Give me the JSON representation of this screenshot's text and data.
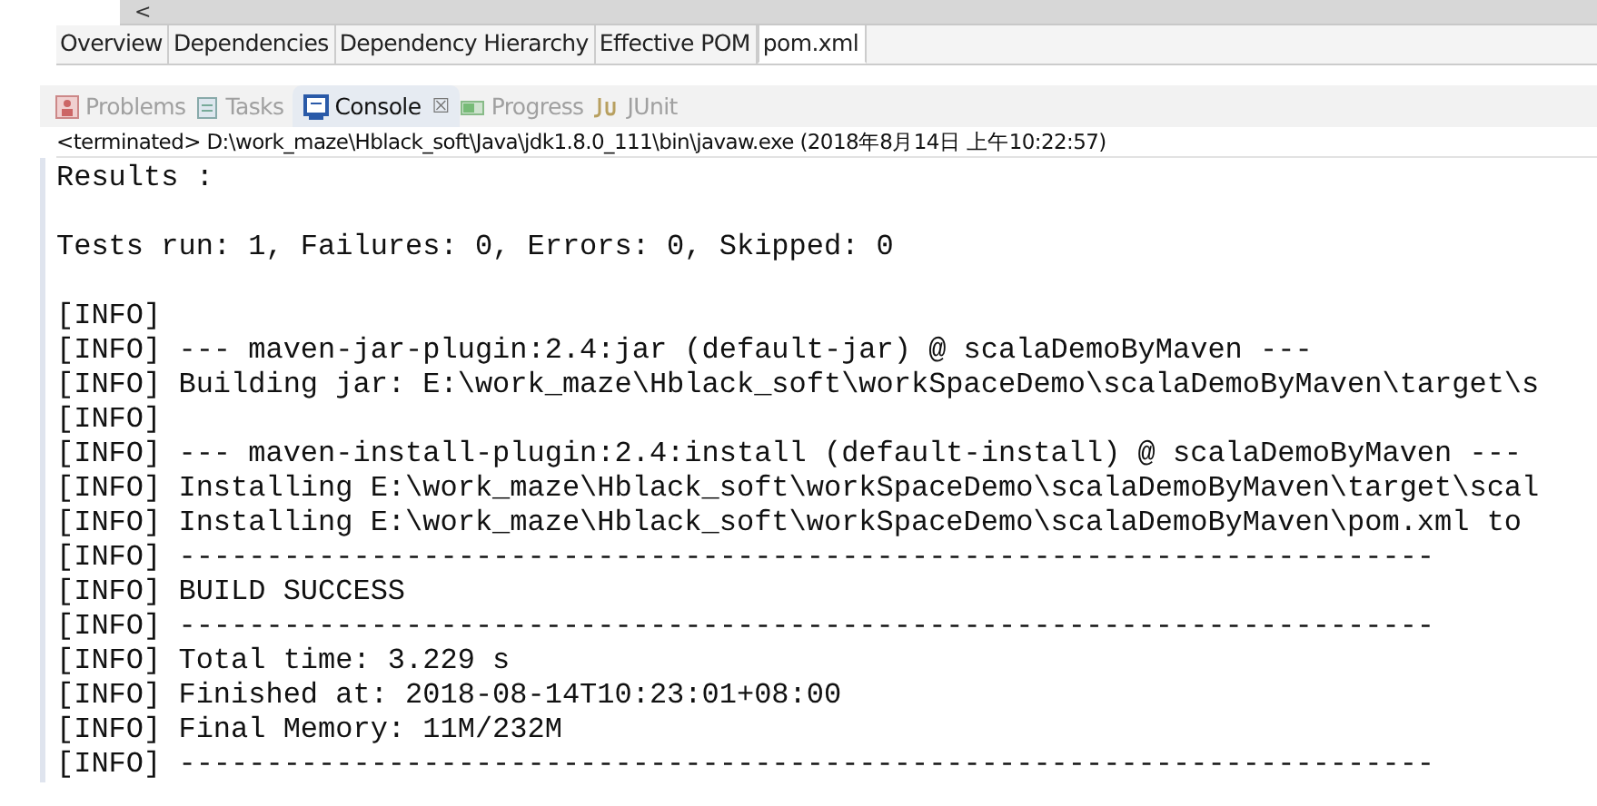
{
  "scroll_arrow": "<",
  "editor_tabs": [
    {
      "label": "Overview",
      "selected": false
    },
    {
      "label": "Dependencies",
      "selected": false
    },
    {
      "label": "Dependency Hierarchy",
      "selected": false
    },
    {
      "label": "Effective POM",
      "selected": false
    },
    {
      "label": "pom.xml",
      "selected": true
    }
  ],
  "view_tabs": [
    {
      "label": "Problems",
      "kind": "problems",
      "selected": false
    },
    {
      "label": "Tasks",
      "kind": "tasks",
      "selected": false
    },
    {
      "label": "Console",
      "kind": "console",
      "selected": true,
      "close": "☒"
    },
    {
      "label": "Progress",
      "kind": "progress",
      "selected": false
    },
    {
      "label": "JUnit",
      "kind": "junit",
      "selected": false
    }
  ],
  "console": {
    "status": "<terminated> D:\\work_maze\\Hblack_soft\\Java\\jdk1.8.0_111\\bin\\javaw.exe (2018年8月14日 上午10:22:57)",
    "blocks": [
      [
        "Results :"
      ],
      [
        "Tests run: 1, Failures: 0, Errors: 0, Skipped: 0"
      ],
      [
        "[INFO]",
        "[INFO] --- maven-jar-plugin:2.4:jar (default-jar) @ scalaDemoByMaven ---",
        "[INFO] Building jar: E:\\work_maze\\Hblack_soft\\workSpaceDemo\\scalaDemoByMaven\\target\\s",
        "[INFO]",
        "[INFO] --- maven-install-plugin:2.4:install (default-install) @ scalaDemoByMaven ---",
        "[INFO] Installing E:\\work_maze\\Hblack_soft\\workSpaceDemo\\scalaDemoByMaven\\target\\scal",
        "[INFO] Installing E:\\work_maze\\Hblack_soft\\workSpaceDemo\\scalaDemoByMaven\\pom.xml to",
        "[INFO] ------------------------------------------------------------------------",
        "[INFO] BUILD SUCCESS",
        "[INFO] ------------------------------------------------------------------------",
        "[INFO] Total time: 3.229 s",
        "[INFO] Finished at: 2018-08-14T10:23:01+08:00",
        "[INFO] Final Memory: 11M/232M",
        "[INFO] ------------------------------------------------------------------------"
      ]
    ]
  }
}
